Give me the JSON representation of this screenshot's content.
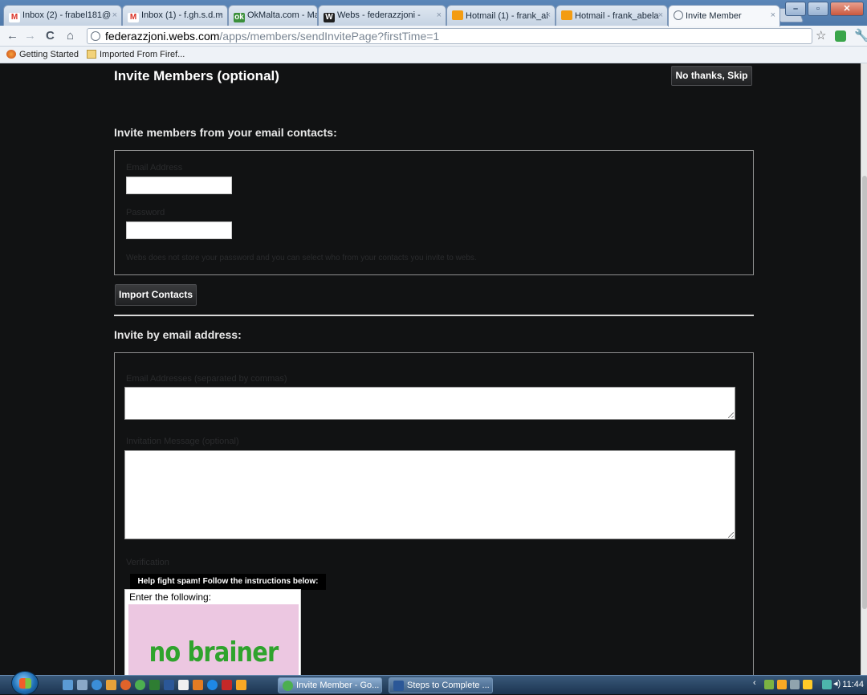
{
  "tabs": [
    {
      "title": "Inbox (2) - frabel181@",
      "icon": "gmail-icon"
    },
    {
      "title": "Inbox (1) - f.gh.s.d.m",
      "icon": "gmail-icon"
    },
    {
      "title": "OkMalta.com - Malta",
      "icon": "okmalta-icon"
    },
    {
      "title": "Webs - federazzjoni -",
      "icon": "webs-icon"
    },
    {
      "title": "Hotmail (1) - frank_al",
      "icon": "hotmail-icon"
    },
    {
      "title": "Hotmail - frank_abela",
      "icon": "hotmail-icon"
    },
    {
      "title": "Invite Member",
      "icon": "globe-icon"
    }
  ],
  "address": {
    "domain": "federazzjoni.webs.com",
    "path": "/apps/members/sendInvitePage?firstTime=1"
  },
  "bookmarks": [
    {
      "label": "Getting Started"
    },
    {
      "label": "Imported From Firef..."
    }
  ],
  "page": {
    "title": "Invite Members (optional)",
    "skip_label": "No thanks, Skip",
    "contacts_heading": "Invite members from your email contacts:",
    "email_label": "Email Address",
    "password_label": "Password",
    "privacy_note": "Webs does not store your password and you can select who from your contacts you invite to webs.",
    "import_label": "Import Contacts",
    "email_heading": "Invite by email address:",
    "addresses_label": "Email Addresses (separated by commas)",
    "message_label": "Invitation Message (optional)",
    "verification_label": "Verification",
    "captcha_header": "Help fight spam!  Follow the instructions below:",
    "captcha_instruction": "Enter the following:",
    "captcha_word": "no brainer"
  },
  "taskbar": {
    "buttons": [
      {
        "label": "Invite Member - Go..."
      },
      {
        "label": "Steps to  Complete ..."
      }
    ],
    "clock": "11:44"
  },
  "colors": {
    "page_bg": "#111213",
    "button_bg": "#2a2b2d",
    "captcha_bg": "#ecc7e1",
    "captcha_text": "#2fa32d"
  }
}
